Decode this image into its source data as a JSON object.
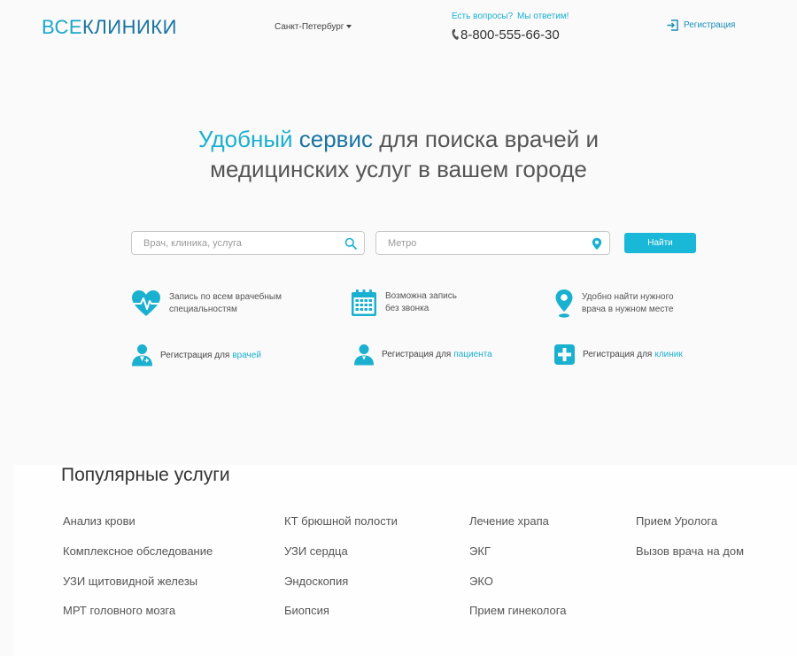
{
  "header": {
    "logo_part1": "ВСЕ",
    "logo_part2": "КЛИНИКИ",
    "city": "Санкт-Петербург",
    "questions_text": "Есть вопросы?",
    "answer_link": "Мы ответим!",
    "phone": "8-800-555-66-30",
    "register_label": "Регистрация"
  },
  "hero": {
    "word1": "Удобный",
    "word2": "сервис",
    "rest_line1": "для поиска врачей и",
    "line2": "медицинских услуг в вашем городе"
  },
  "search": {
    "query_placeholder": "Врач, клиника, услуга",
    "metro_placeholder": "Метро",
    "button_label": "Найти"
  },
  "features": [
    {
      "line1": "Запись по всем врачебным",
      "line2": "специальностям"
    },
    {
      "line1": "Возможна запись",
      "line2": "без звонка"
    },
    {
      "line1": "Удобно найти нужного",
      "line2": "врача в нужном месте"
    }
  ],
  "registration": [
    {
      "prefix": "Регистрация для",
      "accent": "врачей"
    },
    {
      "prefix": "Регистрация для",
      "accent": "пациента"
    },
    {
      "prefix": "Регистрация для",
      "accent": "клиник"
    }
  ],
  "popular": {
    "title": "Популярные услуги",
    "columns": [
      [
        "Анализ крови",
        "Комплексное обследование",
        "УЗИ щитовидной железы",
        "МРТ головного мозга"
      ],
      [
        "КТ брюшной полости",
        "УЗИ сердца",
        "Эндоскопия",
        "Биопсия"
      ],
      [
        "Лечение храпа",
        "ЭКГ",
        "ЭКО",
        "Прием гинеколога"
      ],
      [
        "Прием Уролога",
        "Вызов врача на дом"
      ]
    ]
  },
  "colors": {
    "accent": "#1ab0cf",
    "accent_dark": "#1a73a0",
    "button": "#1ab8d8"
  }
}
